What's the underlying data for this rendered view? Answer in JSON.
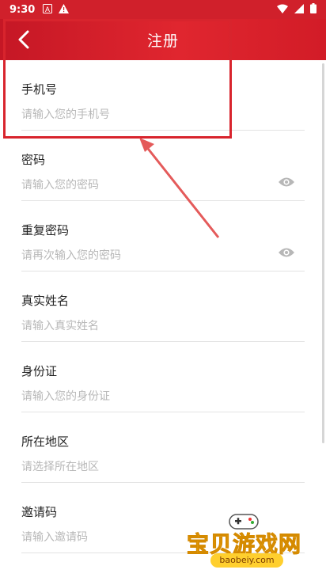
{
  "status_bar": {
    "time": "9:30",
    "icons": [
      "notification-a-icon",
      "warning-icon"
    ],
    "right_icons": [
      "wifi-icon",
      "signal-icon",
      "battery-icon"
    ]
  },
  "app_bar": {
    "back_icon": "back-arrow-icon",
    "title": "注册"
  },
  "form": {
    "fields": [
      {
        "label": "手机号",
        "placeholder": "请输入您的手机号",
        "value": "",
        "has_eye": false
      },
      {
        "label": "密码",
        "placeholder": "请输入您的密码",
        "value": "",
        "has_eye": true
      },
      {
        "label": "重复密码",
        "placeholder": "请再次输入您的密码",
        "value": "",
        "has_eye": true
      },
      {
        "label": "真实姓名",
        "placeholder": "请输入真实姓名",
        "value": "",
        "has_eye": false
      },
      {
        "label": "身份证",
        "placeholder": "请输入您的身份证",
        "value": "",
        "has_eye": false
      },
      {
        "label": "所在地区",
        "placeholder": "请选择所在地区",
        "value": "",
        "has_eye": false
      },
      {
        "label": "邀请码",
        "placeholder": "请输入邀请码",
        "value": "",
        "has_eye": false
      }
    ]
  },
  "watermark": {
    "text": "宝贝游戏网",
    "url": "baobeiy.com"
  },
  "colors": {
    "brand_red": "#d0202b",
    "annotation_red": "#d8242d",
    "placeholder_gray": "#b8b8b8",
    "divider": "#e3e3e3"
  }
}
